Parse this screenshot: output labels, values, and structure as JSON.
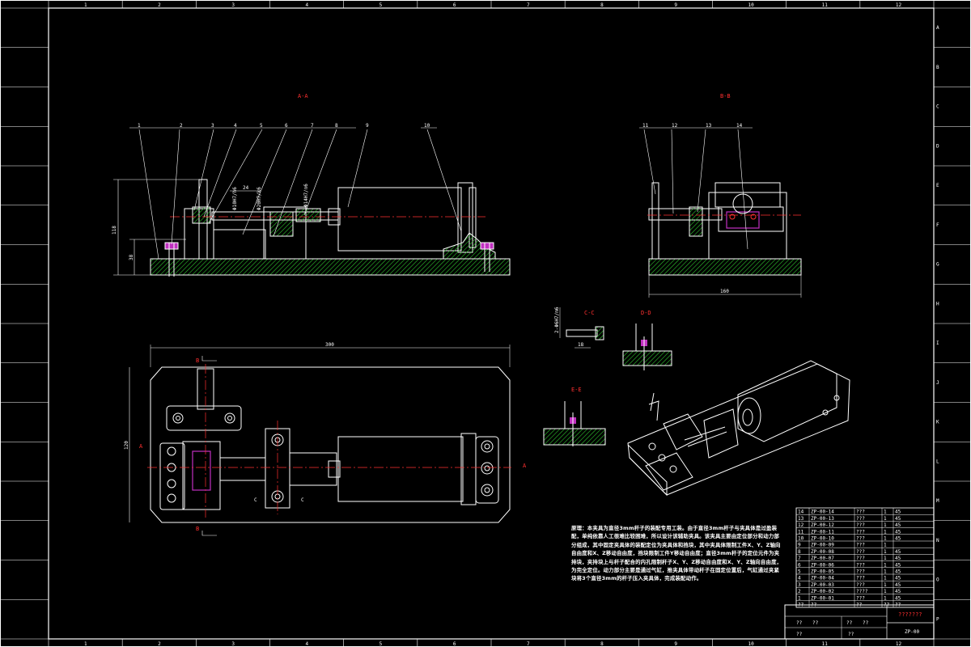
{
  "border": {
    "top_zones": [
      "1",
      "2",
      "3",
      "4",
      "5",
      "6",
      "7",
      "8",
      "9",
      "10",
      "11",
      "12"
    ],
    "side_zones": [
      "A",
      "B",
      "C",
      "D",
      "E",
      "F",
      "G",
      "H",
      "I",
      "J",
      "K",
      "L",
      "M",
      "N",
      "O",
      "P"
    ]
  },
  "views": {
    "section_aa_label": "A-A",
    "section_bb_label": "B-B",
    "detail_cc_label": "C-C",
    "detail_dd_label": "D-D",
    "detail_ee_label": "E-E",
    "plan_marks": {
      "a_left": "A",
      "a_right": "A",
      "b_top": "B",
      "b_bottom": "B",
      "c_left": "C",
      "c_right": "C"
    }
  },
  "balloons": [
    "1",
    "2",
    "3",
    "4",
    "5",
    "6",
    "7",
    "8",
    "9",
    "10",
    "11",
    "12",
    "13",
    "14"
  ],
  "dimensions": {
    "overall_length": "300",
    "overall_width": "120",
    "height_total": "118",
    "height_base": "38",
    "side_width": "160",
    "bore_1": "Φ10H7/h6",
    "bore_2": "Φ20H7/k6",
    "bore_3": "Φ14H7/n6",
    "span": "24",
    "detail_dim": "2-Φ6H7/m6",
    "detail_small": "18"
  },
  "note": "原理：本夹具为直径3mm杆子的装配专用工装。由于直径3mm杆子与夹具体是过盈装配，单纯依靠人工很难比较困难，所以设计该辅助夹具。该夹具主要由定位部分和动力部分组成，其中固定夹具体的装配定位为夹具体和挡块，其中夹具体限制工件X、Y、Z轴向自由度和X、Z移动自由度，挡块限制工件Y移动自由度；直径3mm杆子的定位元件为夹持块，夹持块上与杆子配合的内孔限制杆子X、Y、Z移动自由度和X、Y、Z轴向自由度，为完全定位。动力部分主要是通过气缸，推夹具体带动杆子在固定位置后，气缸通过夹紧块将3个直径3mm的杆子压入夹具体，完成装配动作。",
  "bom": {
    "rows": [
      [
        "14",
        "ZP-00-14",
        "???",
        "1",
        "45"
      ],
      [
        "13",
        "ZP-00-13",
        "???",
        "1",
        "45"
      ],
      [
        "12",
        "ZP-00-12",
        "???",
        "1",
        "45"
      ],
      [
        "11",
        "ZP-00-11",
        "???",
        "1",
        "45"
      ],
      [
        "10",
        "ZP-00-10",
        "???",
        "1",
        "45"
      ],
      [
        "9",
        "ZP-00-09",
        "???",
        "1",
        ""
      ],
      [
        "8",
        "ZP-00-08",
        "???",
        "1",
        "45"
      ],
      [
        "7",
        "ZP-00-07",
        "???",
        "1",
        "45"
      ],
      [
        "6",
        "ZP-00-06",
        "???",
        "1",
        "45"
      ],
      [
        "5",
        "ZP-00-05",
        "???",
        "1",
        "45"
      ],
      [
        "4",
        "ZP-00-04",
        "???",
        "1",
        "45"
      ],
      [
        "3",
        "ZP-00-03",
        "???",
        "1",
        "45"
      ],
      [
        "2",
        "ZP-00-02",
        "????",
        "1",
        "45"
      ],
      [
        "1",
        "ZP-00-01",
        "???",
        "1",
        "45"
      ]
    ],
    "header": [
      "??",
      "??",
      "??",
      "??",
      "??"
    ]
  },
  "title_block": {
    "name": "???????",
    "code": "ZP-00",
    "cells": [
      "??",
      "??",
      "??",
      "??",
      "??",
      "??",
      "??",
      "?",
      "?",
      "?",
      "?"
    ]
  }
}
